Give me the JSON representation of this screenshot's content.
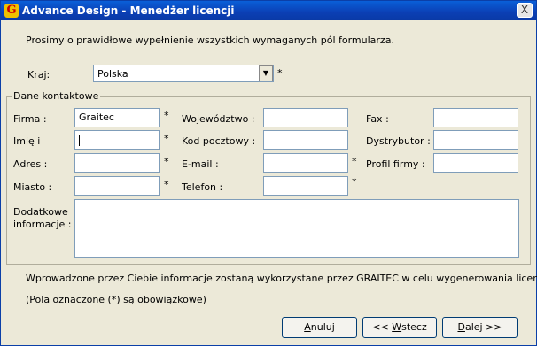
{
  "window": {
    "title": "Advance Design - Menedżer licencji",
    "close_glyph": "X",
    "app_icon_glyph": "G"
  },
  "intro": "Prosimy o prawidłowe wypełnienie wszystkich wymaganych pól formularza.",
  "country": {
    "label": "Kraj:",
    "value": "Polska",
    "required": "*"
  },
  "contact": {
    "group_title": "Dane kontaktowe",
    "firma": {
      "label": "Firma :",
      "value": "Graitec",
      "required": "*"
    },
    "imie": {
      "label": "Imię i",
      "value": "",
      "required": "*"
    },
    "adres": {
      "label": "Adres :",
      "value": "",
      "required": "*"
    },
    "miasto": {
      "label": "Miasto :",
      "value": "",
      "required": "*"
    },
    "wojewodztwo": {
      "label": "Województwo :",
      "value": ""
    },
    "kod": {
      "label": "Kod pocztowy :",
      "value": ""
    },
    "email": {
      "label": "E-mail :",
      "value": "",
      "required": "*"
    },
    "telefon": {
      "label": "Telefon :",
      "value": "",
      "required": "*"
    },
    "fax": {
      "label": "Fax :",
      "value": ""
    },
    "dystrybutor": {
      "label": "Dystrybutor :",
      "value": ""
    },
    "profil": {
      "label": "Profil firmy :",
      "value": ""
    },
    "dodatkowe": {
      "label_line1": "Dodatkowe",
      "label_line2": "informacje :",
      "value": ""
    }
  },
  "notes": {
    "info": "Wprowadzone przez Ciebie informacje zostaną wykorzystane przez GRAITEC w celu wygenerowania licencji.",
    "required_note": "(Pola oznaczone (*) są obowiązkowe)"
  },
  "buttons": {
    "cancel_hotkey": "A",
    "cancel_rest": "nuluj",
    "back_prefix": "<< ",
    "back_hotkey": "W",
    "back_rest": "stecz",
    "next_hotkey": "D",
    "next_rest": "alej >>"
  }
}
